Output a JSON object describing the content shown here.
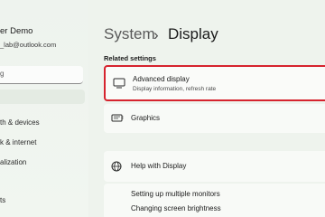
{
  "sidebar": {
    "user_name": "er Demo",
    "user_email": "_lab@outlook.com",
    "search_value": "g",
    "items": [
      {
        "label": "th & devices"
      },
      {
        "label": "k & internet"
      },
      {
        "label": "alization"
      },
      {
        "label": "ts"
      }
    ]
  },
  "header": {
    "breadcrumb_root": "System",
    "breadcrumb_sep": "›",
    "breadcrumb_current": "Display"
  },
  "related": {
    "section_title": "Related settings",
    "advanced": {
      "label": "Advanced display",
      "description": "Display information, refresh rate"
    },
    "graphics": {
      "label": "Graphics"
    }
  },
  "help": {
    "title": "Help with Display",
    "links": [
      {
        "label": "Setting up multiple monitors"
      },
      {
        "label": "Changing screen brightness"
      }
    ]
  },
  "colors": {
    "highlight_border": "#d6232e",
    "accent": "#0067c0"
  }
}
